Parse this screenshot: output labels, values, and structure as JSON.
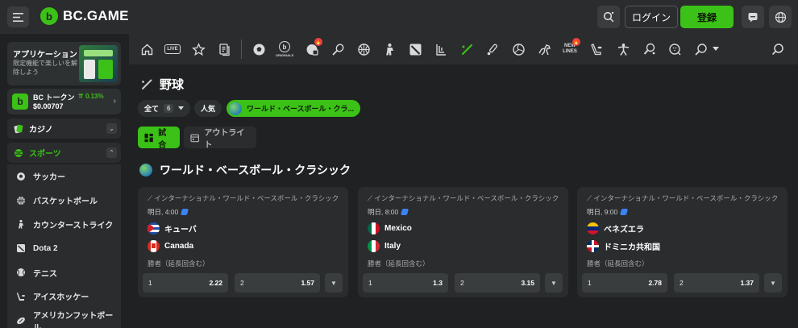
{
  "header": {
    "logo_text": "BC.GAME",
    "login_label": "ログイン",
    "signup_label": "登録"
  },
  "sidebar": {
    "app_title": "アプリケーション",
    "app_desc": "限定機能で楽しいを解除しよう",
    "token_name": "BC トークン",
    "token_change": "0.13%",
    "token_price": "$0.00707",
    "casino_label": "カジノ",
    "sports_label": "スポーツ",
    "sport_items": [
      {
        "label": "サッカー",
        "icon": "soccer-icon"
      },
      {
        "label": "バスケットボール",
        "icon": "basketball-icon"
      },
      {
        "label": "カウンターストライク",
        "icon": "counter-strike-icon"
      },
      {
        "label": "Dota 2",
        "icon": "dota2-icon"
      },
      {
        "label": "テニス",
        "icon": "tennis-icon"
      },
      {
        "label": "アイスホッケー",
        "icon": "ice-hockey-icon"
      },
      {
        "label": "アメリカンフットボール",
        "icon": "american-football-icon"
      }
    ]
  },
  "sportsbar": {
    "live_label": "LIVE",
    "originals_label": "ORIGINALS",
    "newlines_label": "NEW LINES"
  },
  "main": {
    "page_title": "野球",
    "filter_all_label": "全て",
    "filter_all_count": "6",
    "filter_popular_label": "人気",
    "filter_wbc_label": "ワールド・ベースボール・クラ...",
    "tab_matches": "試合",
    "tab_outright": "アウトライト",
    "section_title": "ワールド・ベースボール・クラシック",
    "matches": [
      {
        "league": "インターナショナル・ワールド・ベースボール・クラシック",
        "time": "明日, 4:00",
        "team1": "キューバ",
        "team2": "Canada",
        "market": "勝者（延長回含む）",
        "odd1_label": "1",
        "odd1_value": "2.22",
        "odd2_label": "2",
        "odd2_value": "1.57"
      },
      {
        "league": "インターナショナル・ワールド・ベースボール・クラシック",
        "time": "明日, 8:00",
        "team1": "Mexico",
        "team2": "Italy",
        "market": "勝者（延長回含む）",
        "odd1_label": "1",
        "odd1_value": "1.3",
        "odd2_label": "2",
        "odd2_value": "3.15"
      },
      {
        "league": "インターナショナル・ワールド・ベースボール・クラシック",
        "time": "明日, 9:00",
        "team1": "ベネズエラ",
        "team2": "ドミニカ共和国",
        "market": "勝者（延長回含む）",
        "odd1_label": "1",
        "odd1_value": "2.78",
        "odd2_label": "2",
        "odd2_value": "1.37"
      }
    ]
  },
  "colors": {
    "accent": "#3bc117",
    "background": "#1f2122",
    "panel": "#2a2c2d"
  }
}
